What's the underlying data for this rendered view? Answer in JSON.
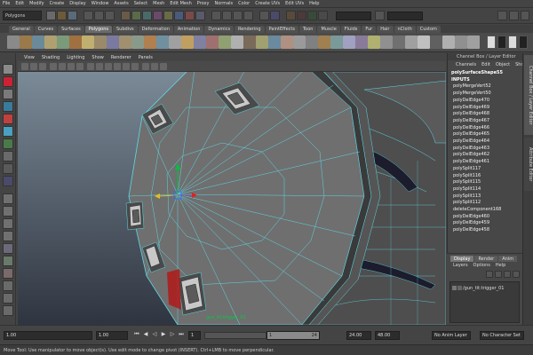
{
  "menubar": {
    "items": [
      "File",
      "Edit",
      "Modify",
      "Create",
      "Display",
      "Window",
      "Assets",
      "Select",
      "Mesh",
      "Edit Mesh",
      "Proxy",
      "Normals",
      "Color",
      "Create UVs",
      "Edit UVs",
      "Help"
    ]
  },
  "statusline": {
    "mode": "Polygons"
  },
  "shelf": {
    "tabs": [
      "General",
      "Curves",
      "Surfaces",
      "Polygons",
      "Subdivs",
      "Deformation",
      "Animation",
      "Dynamics",
      "Rendering",
      "PaintEffects",
      "Toon",
      "Muscle",
      "Fluids",
      "Fur",
      "Hair",
      "nCloth",
      "Custom"
    ],
    "active_tab": "Polygons"
  },
  "panel": {
    "menu": [
      "View",
      "Shading",
      "Lighting",
      "Show",
      "Renderer",
      "Panels"
    ],
    "object_label": "gun_tit:trigger_01"
  },
  "channel_box": {
    "title": "Channel Box / Layer Editor",
    "menu": [
      "Channels",
      "Edit",
      "Object",
      "Show"
    ],
    "shape": "polySurfaceShape55",
    "inputs_header": "INPUTS",
    "inputs": [
      "polyMergeVert52",
      "polyMergeVert50",
      "polyDelEdge470",
      "polyDelEdge469",
      "polyDelEdge468",
      "polyDelEdge467",
      "polyDelEdge466",
      "polyDelEdge465",
      "polyDelEdge464",
      "polyDelEdge463",
      "polyDelEdge462",
      "polyDelEdge461",
      "polySplit117",
      "polySplit116",
      "polySplit115",
      "polySplit114",
      "polySplit113",
      "polySplit112",
      "deleteComponent168",
      "polyDelEdge460",
      "polyDelEdge459",
      "polyDelEdge458"
    ]
  },
  "side_tabs": [
    "Channel Box / Layer Editor",
    "Attribute Editor"
  ],
  "layer_editor": {
    "tabs": [
      "Display",
      "Render",
      "Anim"
    ],
    "active_tab": "Display",
    "menu": [
      "Layers",
      "Options",
      "Help"
    ],
    "layer_name": "/gun_tit:trigger_01"
  },
  "timeslider": {
    "start_time": "1.00",
    "playback_start": "1.00",
    "current_frame": "1",
    "range_frame": "1",
    "range_end": "24",
    "playback_end": "24.00",
    "end_time": "48.00",
    "anim_layer": "No Anim Layer",
    "character_set": "No Character Set"
  },
  "helpline": {
    "text": "Move Tool: Use manipulator to move object(s). Use edit mode to change pivot (INSERT).  Ctrl+LMB to move perpendicular."
  },
  "colors": {
    "wire": "#5fd7e6",
    "mesh_face": "#6f6f6f",
    "bg_top": "#7b8a97",
    "bg_bottom": "#2f3540",
    "selection_red": "#b01a1a",
    "manip_green": "#00c040",
    "manip_blue": "#2a6cff"
  }
}
